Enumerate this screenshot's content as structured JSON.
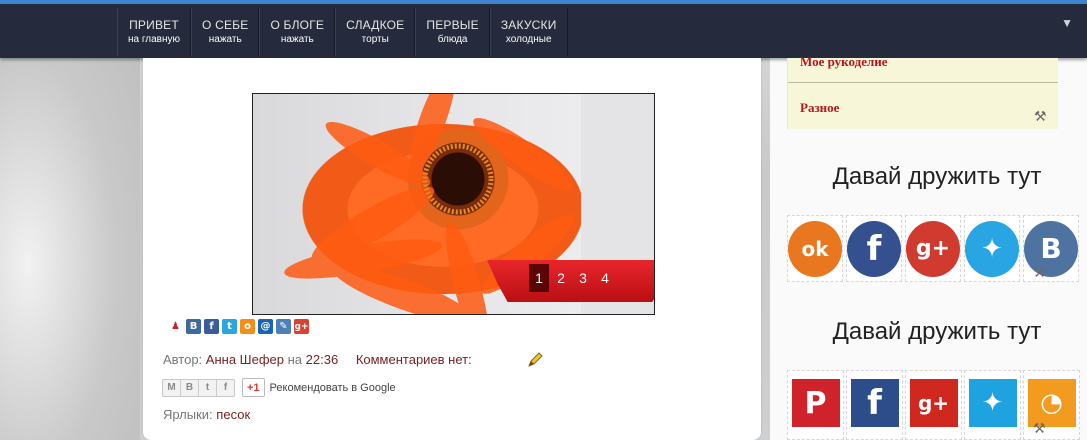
{
  "nav": {
    "items": [
      {
        "title": "ПРИВЕТ",
        "sub": "на главную"
      },
      {
        "title": "О СЕБЕ",
        "sub": "нажать"
      },
      {
        "title": "О БЛОГЕ",
        "sub": "нажать"
      },
      {
        "title": "СЛАДКОЕ",
        "sub": "торты"
      },
      {
        "title": "ПЕРВЫЕ",
        "sub": "блюда"
      },
      {
        "title": "ЗАКУСКИ",
        "sub": "холодные"
      }
    ]
  },
  "slider": {
    "pages": [
      "1",
      "2",
      "3",
      "4"
    ],
    "active_page": "1"
  },
  "share_icons": [
    {
      "icon": "share-person-icon",
      "glyph": "➔",
      "color": "#c2262d"
    },
    {
      "icon": "vk-icon",
      "glyph": "B",
      "color": "#3d6aa0"
    },
    {
      "icon": "facebook-icon",
      "glyph": "f",
      "color": "#3b5b99"
    },
    {
      "icon": "twitter-icon",
      "glyph": "t",
      "color": "#2ca6e0"
    },
    {
      "icon": "odnoklassniki-icon",
      "glyph": "ok",
      "color": "#f0901a"
    },
    {
      "icon": "mailru-icon",
      "glyph": "@",
      "color": "#1a64b2"
    },
    {
      "icon": "livejournal-icon",
      "glyph": "✎",
      "color": "#4d7fb8"
    },
    {
      "icon": "googleplus-icon",
      "glyph": "g+",
      "color": "#d34434"
    }
  ],
  "post": {
    "author_prefix": "Автор:",
    "author": "Анна Шефер",
    "time_prefix": "на",
    "time": "22:36",
    "comments": "Комментариев нет:",
    "labels_prefix": "Ярлыки:",
    "label": "песок",
    "gplus_label": "+1",
    "gplus_text": "Рекомендовать в Google",
    "mini_share": [
      "M",
      "B",
      "t",
      "f"
    ]
  },
  "sidebar": {
    "categories": [
      "Мое рукоделие",
      "Разное"
    ],
    "friends_title_1": "Давай дружить тут",
    "friends_title_2": "Давай дружить тут",
    "round_icons": [
      {
        "icon": "odnoklassniki-icon",
        "glyph": "ok",
        "color": "#e8771f"
      },
      {
        "icon": "facebook-icon",
        "glyph": "f",
        "color": "#34508e"
      },
      {
        "icon": "googleplus-icon",
        "glyph": "g+",
        "color": "#d03a2f"
      },
      {
        "icon": "twitter-icon",
        "glyph": "✦",
        "color": "#2aa5e4"
      },
      {
        "icon": "vk-icon",
        "glyph": "B",
        "color": "#4f73a1"
      }
    ],
    "square_icons": [
      {
        "icon": "pinterest-icon",
        "glyph": "P",
        "color": "#d0222a"
      },
      {
        "icon": "facebook-icon",
        "glyph": "f",
        "color": "#2d4d8a"
      },
      {
        "icon": "googleplus-icon",
        "glyph": "g+",
        "color": "#d0281f"
      },
      {
        "icon": "twitter-icon",
        "glyph": "✦",
        "color": "#1ea2e0"
      },
      {
        "icon": "rss-icon",
        "glyph": "◔",
        "color": "#f29b1f"
      }
    ]
  }
}
